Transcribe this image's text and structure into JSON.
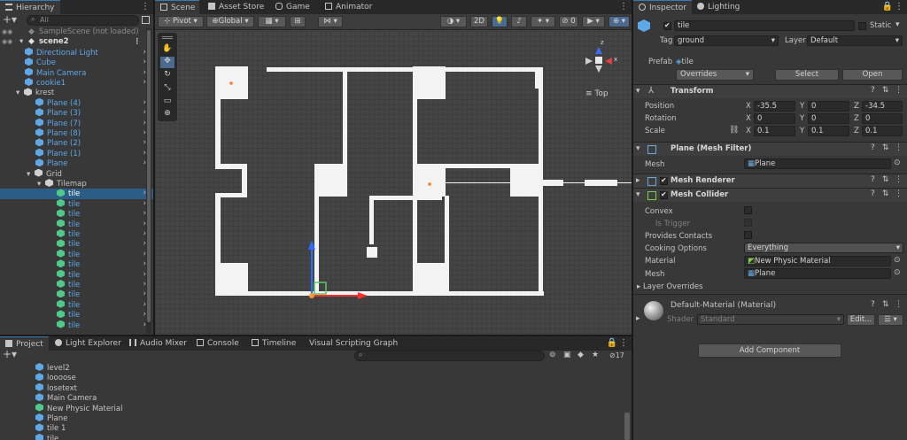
{
  "hierarchy": {
    "tab": "Hierarchy",
    "search_placeholder": "All",
    "items": [
      {
        "label": "SampleScene (not loaded)",
        "indent": 0,
        "type": "scene-unloaded"
      },
      {
        "label": "scene2",
        "indent": 0,
        "type": "scene"
      },
      {
        "label": "Directional Light",
        "indent": 1,
        "type": "obj"
      },
      {
        "label": "Cube",
        "indent": 1,
        "type": "obj"
      },
      {
        "label": "Main Camera",
        "indent": 1,
        "type": "obj"
      },
      {
        "label": "cookie1",
        "indent": 1,
        "type": "obj"
      },
      {
        "label": "krest",
        "indent": 1,
        "type": "parent"
      },
      {
        "label": "Plane (4)",
        "indent": 2,
        "type": "obj"
      },
      {
        "label": "Plane (3)",
        "indent": 2,
        "type": "obj"
      },
      {
        "label": "Plane (7)",
        "indent": 2,
        "type": "obj"
      },
      {
        "label": "Plane (8)",
        "indent": 2,
        "type": "obj"
      },
      {
        "label": "Plane (2)",
        "indent": 2,
        "type": "obj"
      },
      {
        "label": "Plane (1)",
        "indent": 2,
        "type": "obj"
      },
      {
        "label": "Plane",
        "indent": 2,
        "type": "obj"
      },
      {
        "label": "Grid",
        "indent": 2,
        "type": "parent"
      },
      {
        "label": "Tilemap",
        "indent": 3,
        "type": "parent"
      },
      {
        "label": "tile",
        "indent": 4,
        "type": "tile-selected"
      },
      {
        "label": "tile",
        "indent": 4,
        "type": "tile"
      },
      {
        "label": "tile",
        "indent": 4,
        "type": "tile"
      },
      {
        "label": "tile",
        "indent": 4,
        "type": "tile"
      },
      {
        "label": "tile",
        "indent": 4,
        "type": "tile"
      },
      {
        "label": "tile",
        "indent": 4,
        "type": "tile"
      },
      {
        "label": "tile",
        "indent": 4,
        "type": "tile"
      },
      {
        "label": "tile",
        "indent": 4,
        "type": "tile"
      },
      {
        "label": "tile",
        "indent": 4,
        "type": "tile"
      },
      {
        "label": "tile",
        "indent": 4,
        "type": "tile"
      },
      {
        "label": "tile",
        "indent": 4,
        "type": "tile"
      },
      {
        "label": "tile",
        "indent": 4,
        "type": "tile"
      },
      {
        "label": "tile",
        "indent": 4,
        "type": "tile"
      },
      {
        "label": "tile",
        "indent": 4,
        "type": "tile"
      }
    ]
  },
  "scene": {
    "tabs": [
      "Scene",
      "Asset Store",
      "Game",
      "Animator"
    ],
    "toolbar": {
      "pivot": "Pivot",
      "global": "Global",
      "mode_2d": "2D"
    },
    "gizmo_label": "Top"
  },
  "bottom": {
    "tabs": [
      "Project",
      "Light Explorer",
      "Audio Mixer",
      "Console",
      "Timeline",
      "Visual Scripting Graph"
    ],
    "hidden_count": "17",
    "assets": [
      {
        "label": "level2",
        "icon": "cube"
      },
      {
        "label": "loooose",
        "icon": "cube"
      },
      {
        "label": "losetext",
        "icon": "cube"
      },
      {
        "label": "Main Camera",
        "icon": "cube"
      },
      {
        "label": "New Physic Material",
        "icon": "material"
      },
      {
        "label": "Plane",
        "icon": "cube"
      },
      {
        "label": "tile 1",
        "icon": "cube"
      },
      {
        "label": "tile",
        "icon": "cube"
      }
    ]
  },
  "inspector": {
    "tabs": [
      "Inspector",
      "Lighting"
    ],
    "object_name": "tile",
    "static_label": "Static",
    "tag_label": "Tag",
    "tag_value": "ground",
    "layer_label": "Layer",
    "layer_value": "Default",
    "prefab_label": "Prefab",
    "prefab_value": "tile",
    "overrides": "Overrides",
    "select": "Select",
    "open": "Open",
    "transform": {
      "title": "Transform",
      "position_label": "Position",
      "rotation_label": "Rotation",
      "scale_label": "Scale",
      "position": {
        "x": "-35.5",
        "y": "0",
        "z": "-34.5"
      },
      "rotation": {
        "x": "0",
        "y": "0",
        "z": "0"
      },
      "scale": {
        "x": "0.1",
        "y": "0.1",
        "z": "0.1"
      }
    },
    "mesh_filter": {
      "title": "Plane (Mesh Filter)",
      "mesh_label": "Mesh",
      "mesh_value": "Plane"
    },
    "mesh_renderer": {
      "title": "Mesh Renderer"
    },
    "mesh_collider": {
      "title": "Mesh Collider",
      "convex": "Convex",
      "is_trigger": "Is Trigger",
      "provides_contacts": "Provides Contacts",
      "cooking_options": "Cooking Options",
      "cooking_value": "Everything",
      "material_label": "Material",
      "material_value": "New Physic Material",
      "mesh_label": "Mesh",
      "mesh_value": "Plane",
      "layer_overrides": "Layer Overrides"
    },
    "material": {
      "title": "Default-Material (Material)",
      "shader_label": "Shader",
      "shader_value": "Standard",
      "edit": "Edit..."
    },
    "add_component": "Add Component"
  }
}
